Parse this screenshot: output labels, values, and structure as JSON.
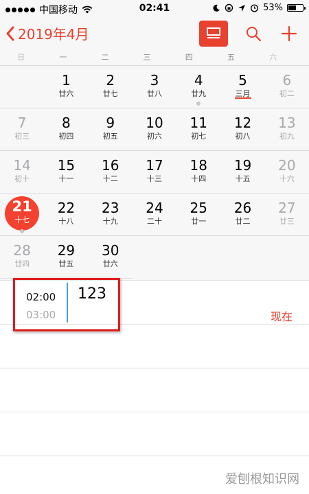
{
  "status_bar": {
    "carrier": "中国移动",
    "time": "02:41",
    "battery": "53%",
    "battery_level": 0.53
  },
  "nav": {
    "back_label": "2019年4月",
    "icons": [
      "list-view-icon",
      "search-icon",
      "add-icon"
    ]
  },
  "weekdays": [
    "日",
    "一",
    "二",
    "三",
    "四",
    "五",
    "六"
  ],
  "calendar": {
    "rows": [
      [
        {
          "day": "",
          "lunar": ""
        },
        {
          "day": "1",
          "lunar": "廿六"
        },
        {
          "day": "2",
          "lunar": "廿七"
        },
        {
          "day": "3",
          "lunar": "廿八"
        },
        {
          "day": "4",
          "lunar": "廿九",
          "event_dot": true
        },
        {
          "day": "5",
          "lunar": "三月",
          "underline": true
        },
        {
          "day": "6",
          "lunar": "初二"
        }
      ],
      [
        {
          "day": "7",
          "lunar": "初三"
        },
        {
          "day": "8",
          "lunar": "初四"
        },
        {
          "day": "9",
          "lunar": "初五"
        },
        {
          "day": "10",
          "lunar": "初六"
        },
        {
          "day": "11",
          "lunar": "初七"
        },
        {
          "day": "12",
          "lunar": "初八"
        },
        {
          "day": "13",
          "lunar": "初九"
        }
      ],
      [
        {
          "day": "14",
          "lunar": "初十"
        },
        {
          "day": "15",
          "lunar": "十一"
        },
        {
          "day": "16",
          "lunar": "十二"
        },
        {
          "day": "17",
          "lunar": "十三"
        },
        {
          "day": "18",
          "lunar": "十四"
        },
        {
          "day": "19",
          "lunar": "十五"
        },
        {
          "day": "20",
          "lunar": "十六"
        }
      ],
      [
        {
          "day": "21",
          "lunar": "十七",
          "today": true,
          "event_dot": true
        },
        {
          "day": "22",
          "lunar": "十八"
        },
        {
          "day": "23",
          "lunar": "十九"
        },
        {
          "day": "24",
          "lunar": "二十"
        },
        {
          "day": "25",
          "lunar": "廿一"
        },
        {
          "day": "26",
          "lunar": "廿二"
        },
        {
          "day": "27",
          "lunar": "廿三"
        }
      ],
      [
        {
          "day": "28",
          "lunar": "廿四"
        },
        {
          "day": "29",
          "lunar": "廿五"
        },
        {
          "day": "30",
          "lunar": "廿六"
        }
      ]
    ]
  },
  "event": {
    "start": "02:00",
    "end": "03:00",
    "title": "123",
    "now_label": "现在"
  },
  "watermark": "爱刨根知识网",
  "colors": {
    "accent": "#e8412f",
    "event_bar": "#4a9ee5",
    "highlight_box": "#e01b1b"
  }
}
